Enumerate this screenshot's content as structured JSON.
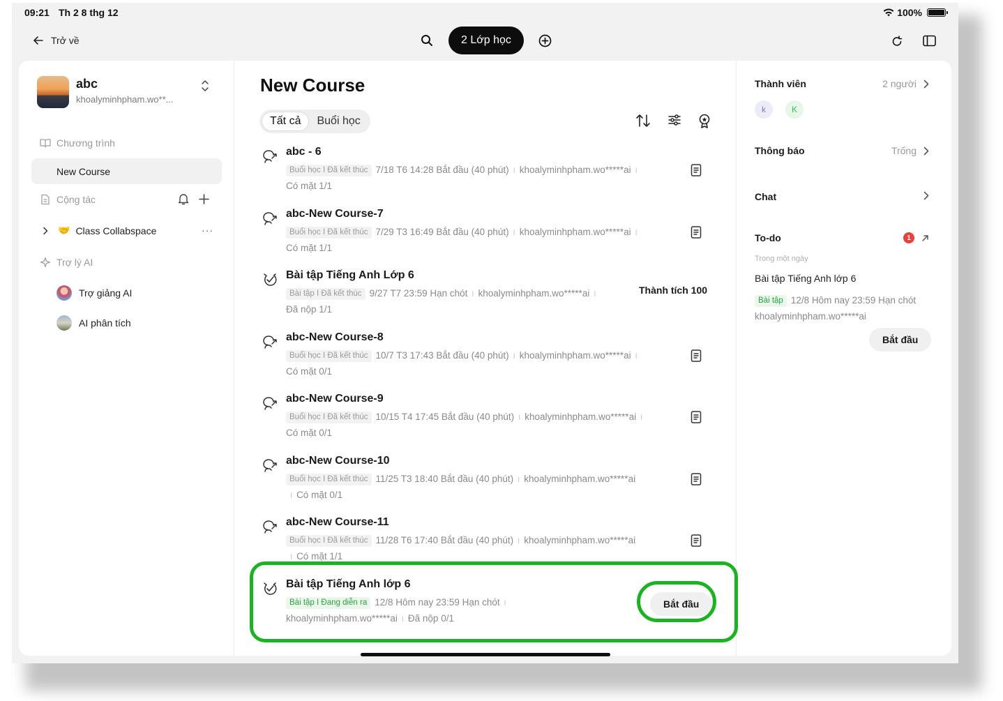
{
  "status": {
    "time": "09:21",
    "date": "Th 2 8 thg 12",
    "battery": "100%"
  },
  "topbar": {
    "back_label": "Trở về",
    "classes_label": "2 Lớp học"
  },
  "sidebar": {
    "workspace_name": "abc",
    "workspace_email": "khoalyminhpham.wo**...",
    "section_program": "Chương trình",
    "active_course": "New Course",
    "section_collab": "Cộng tác",
    "collab_space": "Class Collabspace",
    "collab_more": "···",
    "section_ai": "Trợ lý AI",
    "ai_items": [
      {
        "label": "Trợ giảng AI"
      },
      {
        "label": "AI phân tích"
      }
    ]
  },
  "main": {
    "title": "New Course",
    "tabs": [
      {
        "label": "Tất cả"
      },
      {
        "label": "Buổi học"
      }
    ],
    "items": [
      {
        "title": "abc - 6",
        "tag": "Buổi học I Đã kết thúc",
        "info": "7/18 T6 14:28 Bắt đầu (40 phút)",
        "owner": "khoalyminhpham.wo*****ai",
        "stat": "Có mặt  1/1"
      },
      {
        "title": "abc-New Course-7",
        "tag": "Buổi học I Đã kết thúc",
        "info": "7/29 T3 16:49 Bắt đầu (40 phút)",
        "owner": "khoalyminhpham.wo*****ai",
        "stat": "Có mặt  1/1"
      },
      {
        "title": "Bài tập Tiếng Anh Lớp 6",
        "tag": "Bài tập I Đã kết thúc",
        "info": "9/27 T7 23:59 Hạn chót",
        "owner": "khoalyminhpham.wo*****ai",
        "stat": "Đã nộp  1/1",
        "score": "Thành tích 100"
      },
      {
        "title": "abc-New Course-8",
        "tag": "Buổi học I Đã kết thúc",
        "info": "10/7 T3 17:43 Bắt đầu (40 phút)",
        "owner": "khoalyminhpham.wo*****ai",
        "stat": "Có mặt  0/1"
      },
      {
        "title": "abc-New Course-9",
        "tag": "Buổi học I Đã kết thúc",
        "info": "10/15 T4 17:45 Bắt đầu (40 phút)",
        "owner": "khoalyminhpham.wo*****ai",
        "stat": "Có mặt  0/1"
      },
      {
        "title": "abc-New Course-10",
        "tag": "Buổi học I Đã kết thúc",
        "info": "11/25 T3 18:40 Bắt đầu (40 phút)",
        "owner": "khoalyminhpham.wo*****ai",
        "stat": "Có mặt  0/1"
      },
      {
        "title": "abc-New Course-11",
        "tag": "Buổi học I Đã kết thúc",
        "info": "11/28 T6 17:40 Bắt đầu (40 phút)",
        "owner": "khoalyminhpham.wo*****ai",
        "stat": "Có mặt  1/1"
      },
      {
        "title": "Bài tập Tiếng Anh lớp 6",
        "tag": "Bài tập I Đang diễn ra",
        "info": "12/8 Hôm nay 23:59 Hạn chót",
        "owner": "khoalyminhpham.wo*****ai",
        "stat": "Đã nộp  0/1",
        "button": "Bắt đầu"
      }
    ]
  },
  "right": {
    "members_label": "Thành viên",
    "members_count": "2 người",
    "member_initials": [
      "k",
      "K"
    ],
    "notice_label": "Thông báo",
    "notice_value": "Trống",
    "chat_label": "Chat",
    "todo_label": "To-do",
    "todo_badge": "1",
    "todo_sub": "Trong một ngày",
    "todo_title": "Bài tập Tiếng Anh lớp 6",
    "todo_tag": "Bài tập",
    "todo_info": "12/8 Hôm nay 23:59 Hạn chót",
    "todo_owner": "khoalyminhpham.wo*****ai",
    "todo_button": "Bắt đầu"
  },
  "colors": {
    "highlight": "#19b521",
    "accent_green": "#27a444",
    "badge_red": "#ea3f3f"
  }
}
